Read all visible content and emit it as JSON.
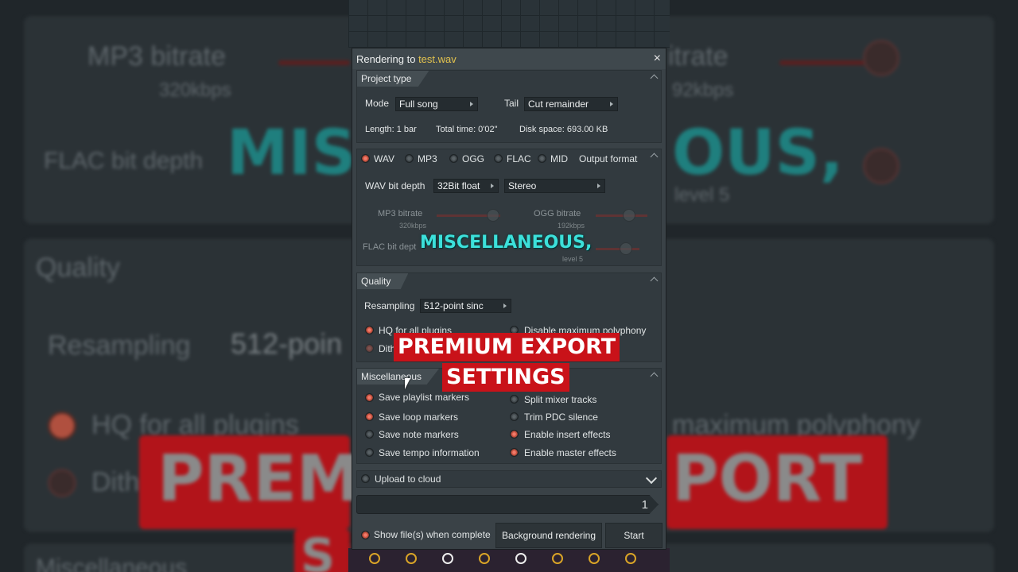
{
  "background": {
    "mp3_bitrate": "MP3 bitrate",
    "mp3_value": "320kbps",
    "flac_depth": "FLAC bit depth",
    "teal_fragment_left": "MIS",
    "teal_fragment_right": "OUS,",
    "right_bitrate": "itrate",
    "right_bitrate_value": "92kbps",
    "right_level": "level 5",
    "quality": "Quality",
    "resampling": "Resampling",
    "resampling_value": "512-poin",
    "hq": "HQ for all plugins",
    "dith": "Dith",
    "max_polyphony": "maximum polyphony",
    "red_left": "PREM",
    "red_right": "PORT",
    "misc": "Miscellaneous",
    "s_letter": "S"
  },
  "dialog": {
    "title_prefix": "Rendering to ",
    "filename": "test.wav",
    "close": "×",
    "project_type": {
      "header": "Project type",
      "mode_label": "Mode",
      "mode_value": "Full song",
      "tail_label": "Tail",
      "tail_value": "Cut remainder",
      "length": "Length: 1 bar",
      "total_time": "Total time: 0'02\"",
      "disk_space": "Disk space: 693.00 KB"
    },
    "output_format": {
      "header": "Output format",
      "formats": [
        "WAV",
        "MP3",
        "OGG",
        "FLAC",
        "MID"
      ],
      "wav_bit_depth_label": "WAV bit depth",
      "wav_bit_depth_value": "32Bit float",
      "channels_value": "Stereo",
      "mp3_bitrate_label": "MP3 bitrate",
      "mp3_bitrate_value": "320kbps",
      "ogg_bitrate_label": "OGG bitrate",
      "ogg_bitrate_value": "192kbps",
      "flac_label": "FLAC bit dept",
      "flac_value": "level 5"
    },
    "quality": {
      "header": "Quality",
      "resampling_label": "Resampling",
      "resampling_value": "512-point sinc",
      "hq_plugins": "HQ for all plugins",
      "disable_polyphony": "Disable maximum polyphony",
      "dither": "Dith"
    },
    "misc": {
      "header": "Miscellaneous",
      "left": [
        "Save playlist markers",
        "Save loop markers",
        "Save note markers",
        "Save tempo information"
      ],
      "left_on": [
        true,
        true,
        false,
        false
      ],
      "right": [
        "Split mixer tracks",
        "Trim PDC silence",
        "Enable insert effects",
        "Enable master effects"
      ],
      "right_on": [
        false,
        false,
        true,
        true
      ]
    },
    "upload": "Upload to cloud",
    "progress_value": "1",
    "show_files": "Show file(s) when complete",
    "background_rendering": "Background rendering",
    "start": "Start"
  },
  "captions": {
    "teal": "MISCELLANEOUS,",
    "red_line1": "PREMIUM EXPORT",
    "red_line2": "SETTINGS"
  },
  "colors": {
    "accent_yellow": "#e3c34e",
    "caption_teal": "#3ce0da",
    "caption_red": "#c91219",
    "radio_on": "#e0604e"
  }
}
